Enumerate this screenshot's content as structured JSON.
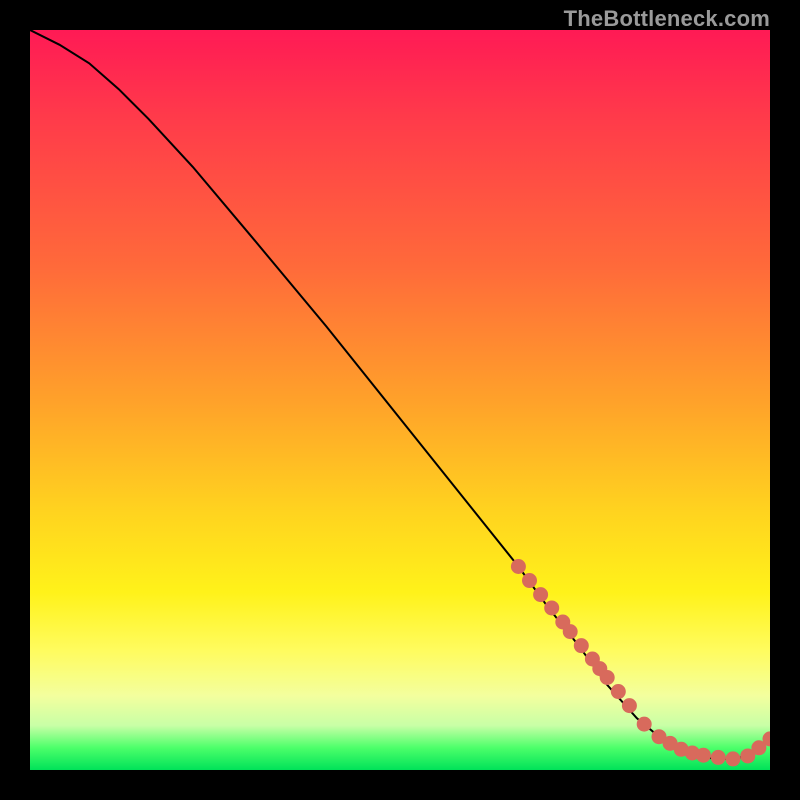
{
  "watermark": "TheBottleneck.com",
  "chart_data": {
    "type": "line",
    "title": "",
    "xlabel": "",
    "ylabel": "",
    "xlim": [
      0,
      100
    ],
    "ylim": [
      0,
      100
    ],
    "series": [
      {
        "name": "curve",
        "x": [
          0,
          4,
          8,
          12,
          16,
          22,
          30,
          40,
          50,
          60,
          66,
          70,
          74,
          78,
          82,
          85,
          88,
          90,
          92,
          94,
          96,
          98,
          100
        ],
        "y": [
          100,
          98,
          95.5,
          92,
          88,
          81.5,
          72,
          60,
          47.5,
          35,
          27.5,
          22,
          17,
          11.5,
          7,
          4.5,
          2.8,
          2.0,
          1.6,
          1.5,
          1.7,
          2.6,
          4.2
        ]
      }
    ],
    "marker_cluster": {
      "name": "dense-markers",
      "color": "#cf5a4f",
      "x": [
        66,
        67.5,
        69,
        70.5,
        72,
        73,
        74.5,
        76,
        77,
        78,
        79.5,
        81,
        83,
        85,
        86.5,
        88,
        89.5,
        91,
        93,
        95,
        97,
        98.5,
        100
      ],
      "y": [
        27.5,
        25.6,
        23.7,
        21.9,
        20.0,
        18.7,
        16.8,
        15.0,
        13.7,
        12.5,
        10.6,
        8.7,
        6.2,
        4.5,
        3.6,
        2.8,
        2.3,
        2.0,
        1.7,
        1.5,
        1.9,
        3.0,
        4.2
      ]
    }
  },
  "style": {
    "marker_radius": 7,
    "line_stroke": "#000000",
    "line_width": 2,
    "marker_fill": "#d86a5c",
    "marker_stroke": "#d86a5c"
  }
}
